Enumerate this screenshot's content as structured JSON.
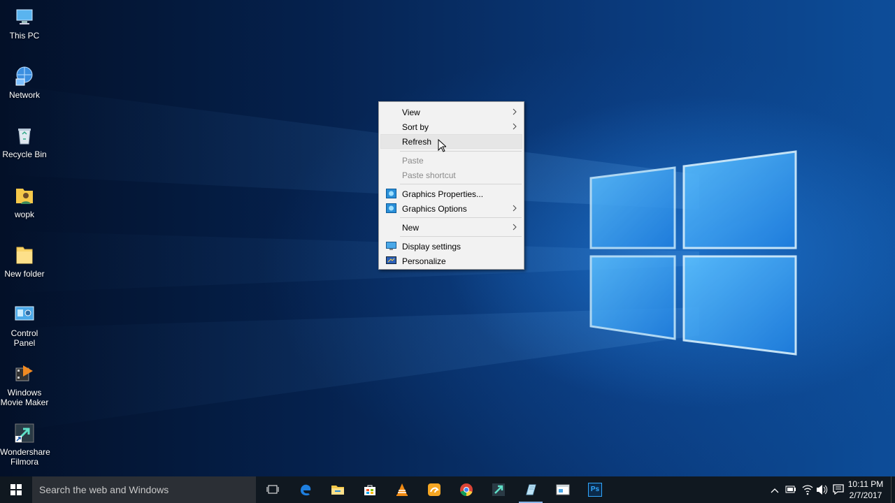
{
  "desktop_icons": [
    {
      "label": "This PC",
      "icon": "this-pc-icon"
    },
    {
      "label": "Network",
      "icon": "network-icon"
    },
    {
      "label": "Recycle Bin",
      "icon": "recycle-bin-icon"
    },
    {
      "label": "wopk",
      "icon": "user-folder-icon"
    },
    {
      "label": "New folder",
      "icon": "folder-icon"
    },
    {
      "label": "Control Panel",
      "icon": "control-panel-icon"
    },
    {
      "label": "Windows Movie Maker",
      "icon": "movie-maker-icon"
    },
    {
      "label": "Wondershare Filmora",
      "icon": "filmora-shortcut-icon"
    }
  ],
  "context_menu": {
    "view": "View",
    "sort_by": "Sort by",
    "refresh": "Refresh",
    "paste": "Paste",
    "paste_shortcut": "Paste shortcut",
    "graphics_properties": "Graphics Properties...",
    "graphics_options": "Graphics Options",
    "new": "New",
    "display_settings": "Display settings",
    "personalize": "Personalize"
  },
  "taskbar": {
    "search_placeholder": "Search the web and Windows",
    "apps": [
      "task-view-icon",
      "edge-icon",
      "file-explorer-icon",
      "store-icon",
      "vlc-icon",
      "uc-browser-icon",
      "chrome-icon",
      "filmora-icon",
      "app-icon",
      "window-app-icon",
      "photoshop-icon"
    ],
    "photoshop_label": "Ps"
  },
  "clock": {
    "time": "10:11 PM",
    "date": "2/7/2017"
  },
  "colors": {
    "accent": "#1e90ff",
    "menu_bg": "#f2f2f2",
    "taskbar_bg": "#101820"
  }
}
